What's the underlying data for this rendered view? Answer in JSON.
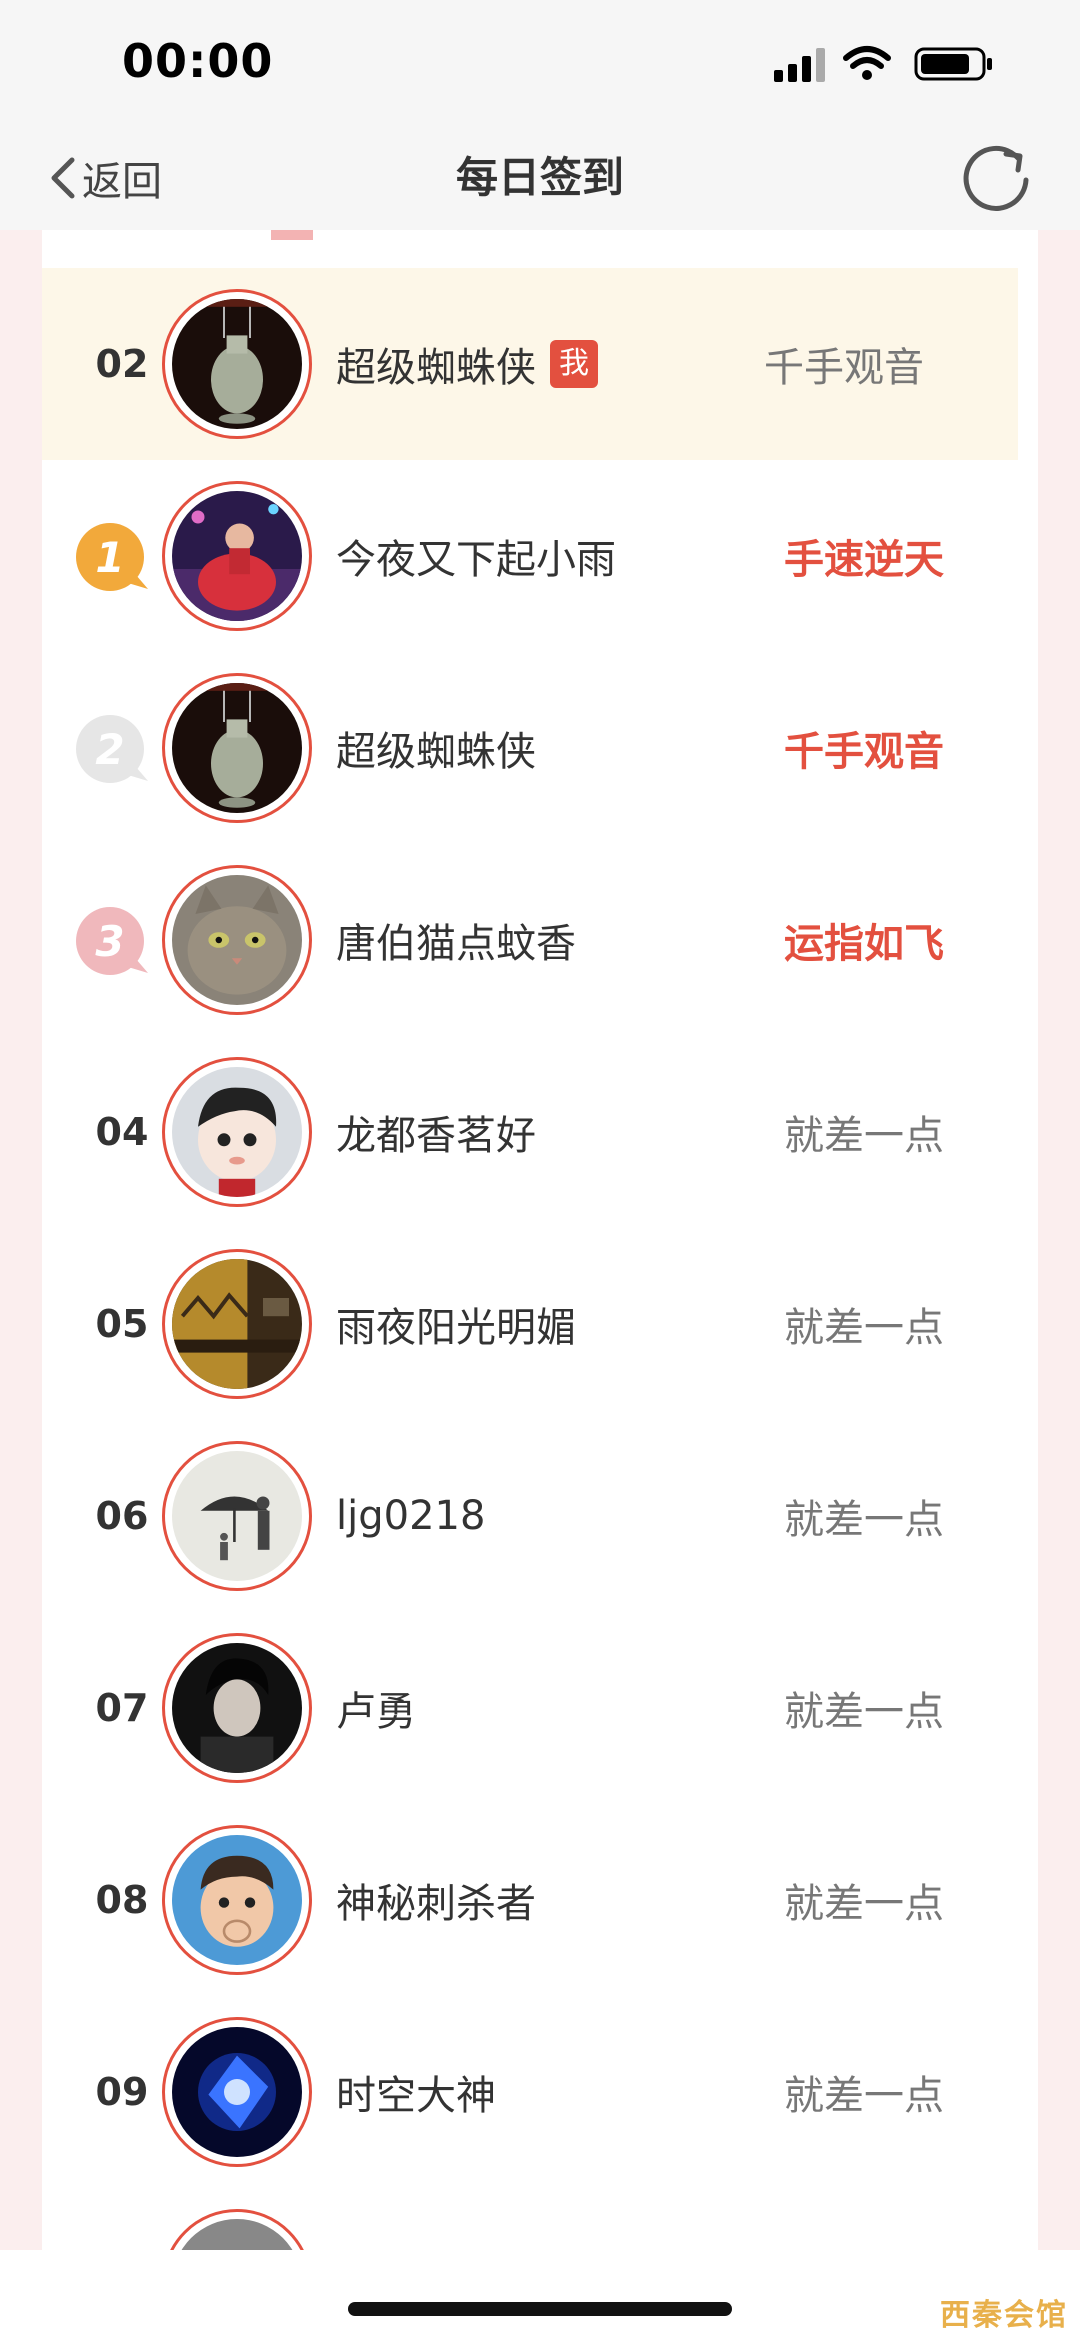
{
  "status_bar": {
    "time": "00:00"
  },
  "nav": {
    "back_label": "返回",
    "title": "每日签到"
  },
  "current_user": {
    "rank": "02",
    "name": "超级蜘蛛侠",
    "me_badge": "我",
    "tag": "千手观音"
  },
  "top3": [
    {
      "name": "今夜又下起小雨",
      "tag": "手速逆天",
      "medal": "gold-medal-1"
    },
    {
      "name": "超级蜘蛛侠",
      "tag": "千手观音",
      "medal": "silver-medal-2"
    },
    {
      "name": "唐伯猫点蚊香",
      "tag": "运指如飞",
      "medal": "bronze-medal-3"
    }
  ],
  "others": [
    {
      "rank": "04",
      "name": "龙都香茗好",
      "tag": "就差一点"
    },
    {
      "rank": "05",
      "name": "雨夜阳光明媚",
      "tag": "就差一点"
    },
    {
      "rank": "06",
      "name": "ljg0218",
      "tag": "就差一点"
    },
    {
      "rank": "07",
      "name": "卢勇",
      "tag": "就差一点"
    },
    {
      "rank": "08",
      "name": "神秘刺杀者",
      "tag": "就差一点"
    },
    {
      "rank": "09",
      "name": "时空大神",
      "tag": "就差一点"
    }
  ],
  "watermark": "西秦会馆",
  "colors": {
    "accent": "#e3503f",
    "highlight_row": "#fdf7e8",
    "gold": "#f2a93b"
  }
}
